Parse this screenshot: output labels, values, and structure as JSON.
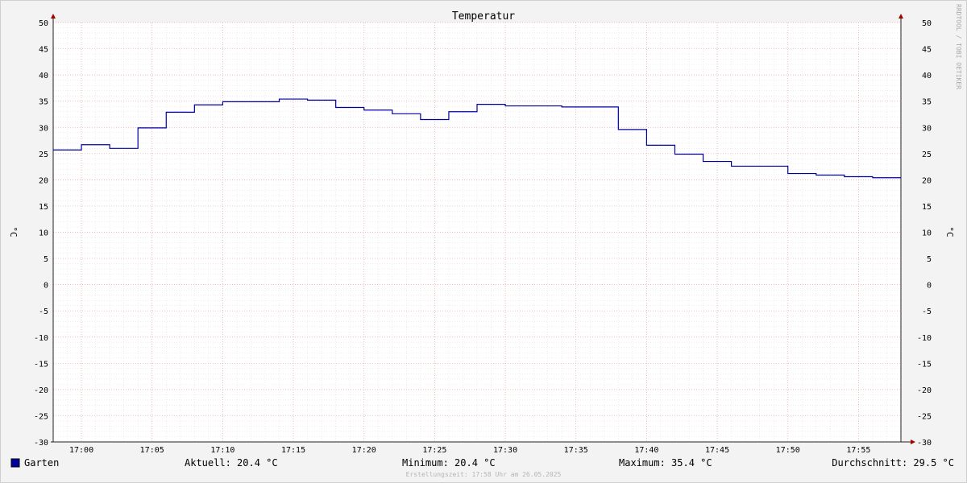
{
  "chart_data": {
    "type": "line",
    "title": "Temperatur",
    "ylabel": "°C",
    "ylabel_right": "°C",
    "ylim": [
      -30,
      50
    ],
    "yticks": [
      50,
      45,
      40,
      35,
      30,
      25,
      20,
      15,
      10,
      5,
      0,
      -5,
      -10,
      -15,
      -20,
      -25,
      -30
    ],
    "xlim": [
      "16:58",
      "17:58"
    ],
    "xticks": [
      "17:00",
      "17:05",
      "17:10",
      "17:15",
      "17:20",
      "17:25",
      "17:30",
      "17:35",
      "17:40",
      "17:45",
      "17:50",
      "17:55"
    ],
    "grid": true,
    "legend_placement": "bottom-left",
    "series": [
      {
        "name": "Garten",
        "color": "#0000a0",
        "step": true,
        "x": [
          "16:58",
          "17:00",
          "17:02",
          "17:04",
          "17:06",
          "17:08",
          "17:10",
          "17:12",
          "17:14",
          "17:16",
          "17:18",
          "17:20",
          "17:22",
          "17:24",
          "17:26",
          "17:28",
          "17:30",
          "17:32",
          "17:34",
          "17:36",
          "17:38",
          "17:40",
          "17:42",
          "17:44",
          "17:46",
          "17:48",
          "17:50",
          "17:52",
          "17:54",
          "17:56"
        ],
        "values": [
          25.7,
          26.7,
          26.0,
          29.9,
          32.9,
          34.3,
          34.9,
          34.9,
          35.4,
          35.2,
          33.8,
          33.3,
          32.6,
          31.5,
          33.0,
          34.4,
          34.1,
          34.1,
          33.9,
          33.9,
          29.6,
          26.6,
          24.9,
          23.5,
          22.6,
          22.6,
          21.2,
          20.9,
          20.6,
          20.4
        ]
      }
    ]
  },
  "legend": {
    "series_name": "Garten",
    "series_color": "#0000a0",
    "current": "Aktuell: 20.4 °C",
    "minimum": "Minimum: 20.4 °C",
    "maximum": "Maximum: 35.4 °C",
    "average": "Durchschnitt: 29.5 °C"
  },
  "footer": {
    "created": "Erstellungszeit: 17:58 Uhr am 26.05.2025"
  },
  "watermark": "RRDTOOL / TOBI OETIKER"
}
